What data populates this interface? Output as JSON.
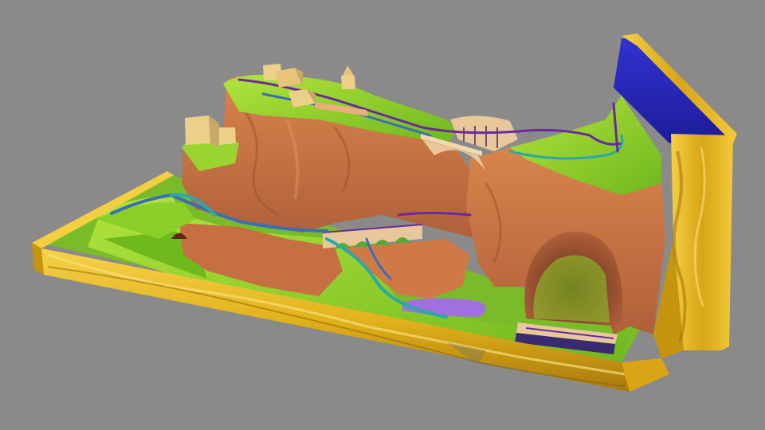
{
  "scene": {
    "kind": "3d-render",
    "subject": "model-railway-layout",
    "colors": {
      "background": "#8a8a8a",
      "frame_gold": "#e2b21c",
      "frame_gold_dark": "#a8780c",
      "frame_gold_light": "#f6d24a",
      "rock": "#cf7a46",
      "rock_dark": "#9c5030",
      "grass": "#86cc28",
      "grass_light": "#b2e43c",
      "track_blue": "#3a6fb8",
      "track_teal": "#2aa9a8",
      "track_purple": "#6a2a9c",
      "backdrop_blue": "#2424b8",
      "bridge_stone": "#e8c89a",
      "building": "#ecd08a",
      "water_violet": "#a070e0"
    },
    "objects": [
      "gold-frame",
      "blue-backdrop",
      "rock-mountain",
      "grass-terrain",
      "arch-bridge",
      "viaduct",
      "tunnel",
      "buildings",
      "railway-tracks"
    ]
  }
}
